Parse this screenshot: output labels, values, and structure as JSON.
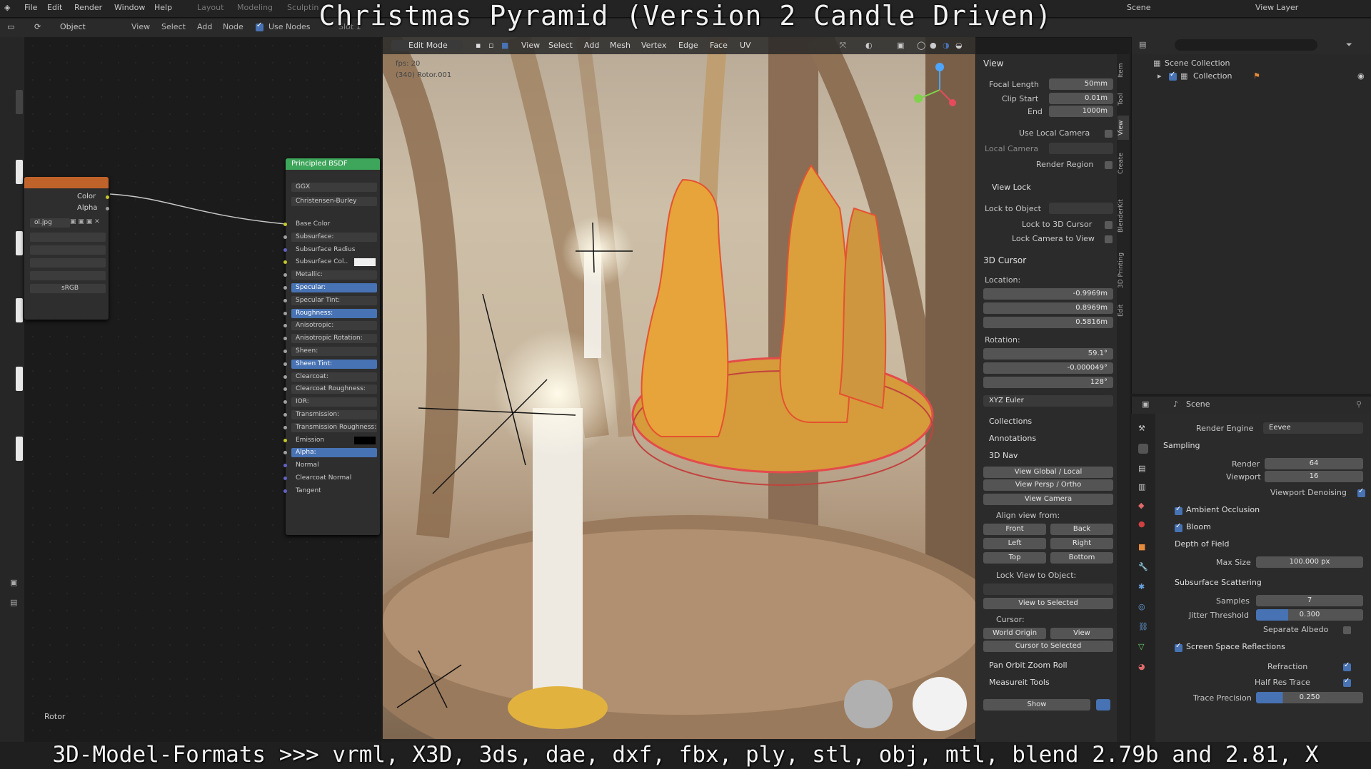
{
  "title_overlay": "Christmas Pyramid (Version 2 Candle Driven)",
  "bottom_overlay": "3D-Model-Formats >>> vrml, X3D, 3ds, dae, dxf, fbx, ply, stl, obj, mtl, blend 2.79b and 2.81, X",
  "menu": {
    "file": "File",
    "edit": "Edit",
    "render": "Render",
    "window": "Window",
    "help": "Help",
    "layout": "Layout",
    "modeling": "Modeling",
    "sculpting": "Sculptin",
    "scene": "Scene",
    "view_layer": "View Layer"
  },
  "node_header": {
    "object": "Object",
    "view": "View",
    "select": "Select",
    "add": "Add",
    "node": "Node",
    "use_nodes": "Use Nodes",
    "slot": "Slot 1"
  },
  "image_node": {
    "color": "Color",
    "alpha": "Alpha",
    "file": "ol.jpg",
    "colorspace": "sRGB"
  },
  "bsdf": {
    "title": "Principled BSDF",
    "ggx": "GGX",
    "sss_method": "Christensen-Burley",
    "inputs": [
      "Base Color",
      "Subsurface:",
      "Subsurface Radius",
      "Subsurface Col..",
      "Metallic:",
      "Specular:",
      "Specular Tint:",
      "Roughness:",
      "Anisotropic:",
      "Anisotropic Rotation:",
      "Sheen:",
      "Sheen Tint:",
      "Clearcoat:",
      "Clearcoat Roughness:",
      "IOR:",
      "Transmission:",
      "Transmission Roughness:",
      "Emission",
      "Alpha:",
      "Normal",
      "Clearcoat Normal",
      "Tangent"
    ]
  },
  "rotor_label": "Rotor",
  "viewport": {
    "mode": "Edit Mode",
    "view": "View",
    "select": "Select",
    "add": "Add",
    "mesh": "Mesh",
    "vertex": "Vertex",
    "edge": "Edge",
    "face": "Face",
    "uv": "UV",
    "fps": "fps: 20",
    "object_info": "(340) Rotor.001"
  },
  "npanel": {
    "view_section": "View",
    "focal_length_label": "Focal Length",
    "focal_length": "50mm",
    "clip_start_label": "Clip Start",
    "clip_start": "0.01m",
    "end_label": "End",
    "end": "1000m",
    "use_local_camera": "Use Local Camera",
    "local_camera": "Local Camera",
    "render_region": "Render Region",
    "view_lock": "View Lock",
    "lock_to_object": "Lock to Object",
    "lock_to_cursor": "Lock to 3D Cursor",
    "lock_camera": "Lock Camera to View",
    "cursor_section": "3D Cursor",
    "location": "Location:",
    "loc_x": "-0.9969m",
    "loc_y": "0.8969m",
    "loc_z": "0.5816m",
    "rotation": "Rotation:",
    "rot_x": "59.1°",
    "rot_y": "-0.000049°",
    "rot_z": "128°",
    "euler": "XYZ Euler",
    "collections": "Collections",
    "annotations": "Annotations",
    "nav": "3D Nav",
    "view_global": "View Global / Local",
    "view_persp": "View Persp / Ortho",
    "view_camera": "View Camera",
    "align_from": "Align view from:",
    "front": "Front",
    "back": "Back",
    "left": "Left",
    "right": "Right",
    "top": "Top",
    "bottom": "Bottom",
    "lock_view_obj": "Lock View to Object:",
    "view_selected": "View to Selected",
    "cursor": "Cursor:",
    "world_origin": "World Origin",
    "cursor_view": "View",
    "cursor_selected": "Cursor to Selected",
    "pan_orbit": "Pan Orbit Zoom Roll",
    "measureit": "Measureit Tools",
    "show": "Show",
    "tabs": [
      "Item",
      "Tool",
      "View",
      "Create",
      "BlenderKit",
      "3D Printing",
      "Edit"
    ]
  },
  "outliner": {
    "scene_collection": "Scene Collection",
    "collection": "Collection"
  },
  "properties": {
    "scene": "Scene",
    "render_engine_label": "Render Engine",
    "render_engine": "Eevee",
    "sampling": "Sampling",
    "render_label": "Render",
    "render_value": "64",
    "viewport_label": "Viewport",
    "viewport_value": "16",
    "viewport_denoising": "Viewport Denoising",
    "ambient_occlusion": "Ambient Occlusion",
    "bloom": "Bloom",
    "dof": "Depth of Field",
    "max_size_label": "Max Size",
    "max_size": "100.000 px",
    "sss": "Subsurface Scattering",
    "samples_label": "Samples",
    "samples": "7",
    "jitter_label": "Jitter Threshold",
    "jitter": "0.300",
    "separate_albedo": "Separate Albedo",
    "ssr": "Screen Space Reflections",
    "refraction": "Refraction",
    "half_res": "Half Res Trace",
    "trace_precision_label": "Trace Precision",
    "trace_precision": "0.250"
  },
  "colors": {
    "accent": "#4772b3",
    "bsdf_header": "#3ea65a",
    "image_header": "#c0632b"
  }
}
